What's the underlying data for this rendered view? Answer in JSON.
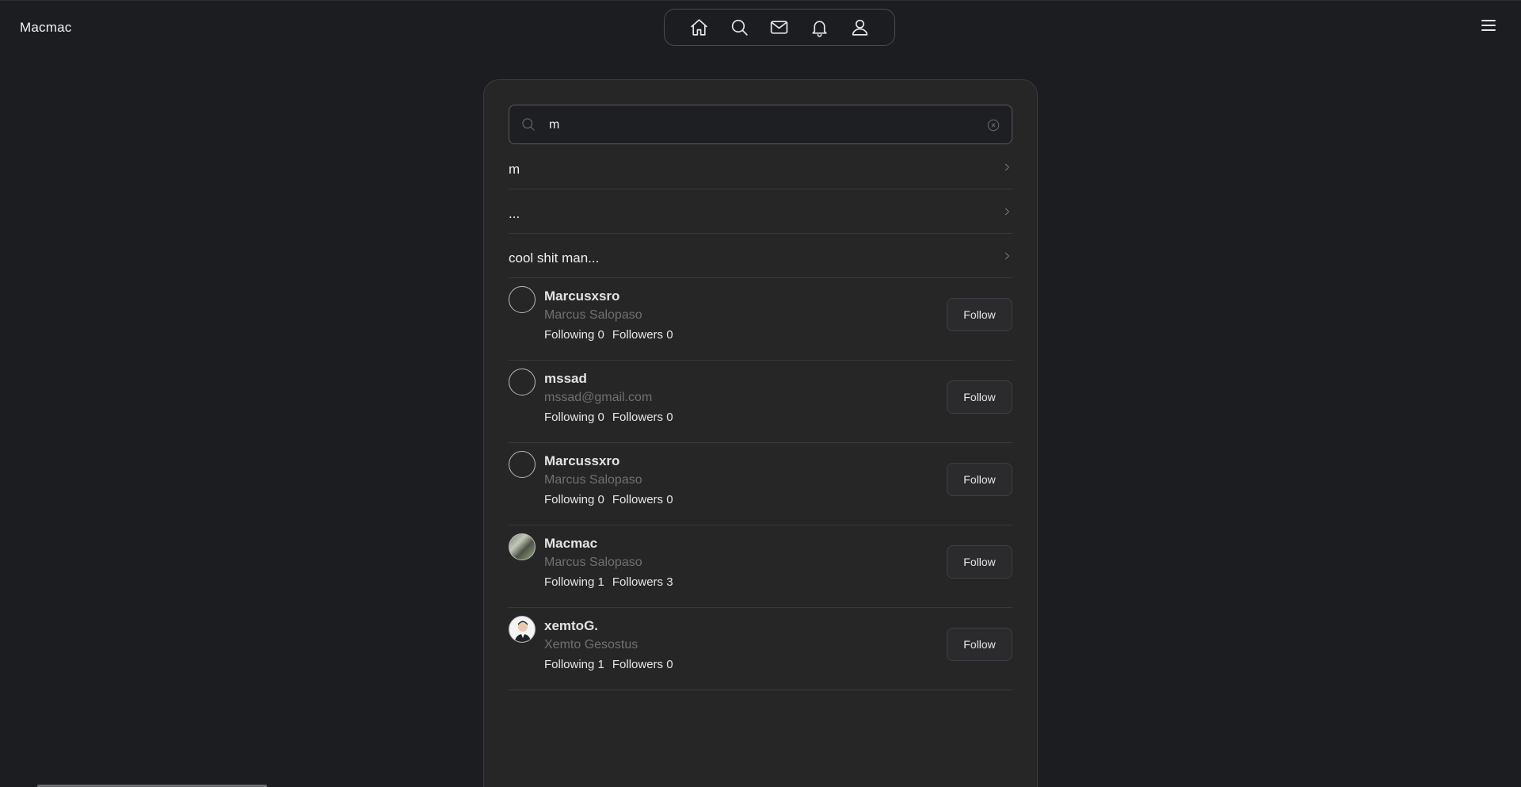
{
  "app": {
    "brand": "Macmac"
  },
  "nav": {
    "items": [
      {
        "name": "home",
        "icon": "home-icon"
      },
      {
        "name": "search",
        "icon": "search-icon"
      },
      {
        "name": "messages",
        "icon": "mail-icon"
      },
      {
        "name": "notifications",
        "icon": "bell-icon"
      },
      {
        "name": "profile",
        "icon": "user-icon"
      }
    ]
  },
  "search": {
    "value": "m",
    "placeholder": ""
  },
  "suggestions": [
    {
      "text": "m"
    },
    {
      "text": "..."
    },
    {
      "text": "cool shit man..."
    }
  ],
  "users": [
    {
      "username": "Marcusxsro",
      "subtitle": "Marcus Salopaso",
      "following": "Following 0",
      "followers": "Followers 0",
      "button": "Follow",
      "avatar": "empty"
    },
    {
      "username": "mssad",
      "subtitle": "mssad@gmail.com",
      "following": "Following 0",
      "followers": "Followers 0",
      "button": "Follow",
      "avatar": "empty"
    },
    {
      "username": "Marcussxro",
      "subtitle": "Marcus Salopaso",
      "following": "Following 0",
      "followers": "Followers 0",
      "button": "Follow",
      "avatar": "empty"
    },
    {
      "username": "Macmac",
      "subtitle": "Marcus Salopaso",
      "following": "Following 1",
      "followers": "Followers 3",
      "button": "Follow",
      "avatar": "photo"
    },
    {
      "username": "xemtoG.",
      "subtitle": "Xemto Gesostus",
      "following": "Following 1",
      "followers": "Followers 0",
      "button": "Follow",
      "avatar": "photo"
    }
  ],
  "colors": {
    "background": "#1c1d20",
    "panel": "#262626",
    "border": "#3a3a3d",
    "muted_text": "#6f7074"
  }
}
